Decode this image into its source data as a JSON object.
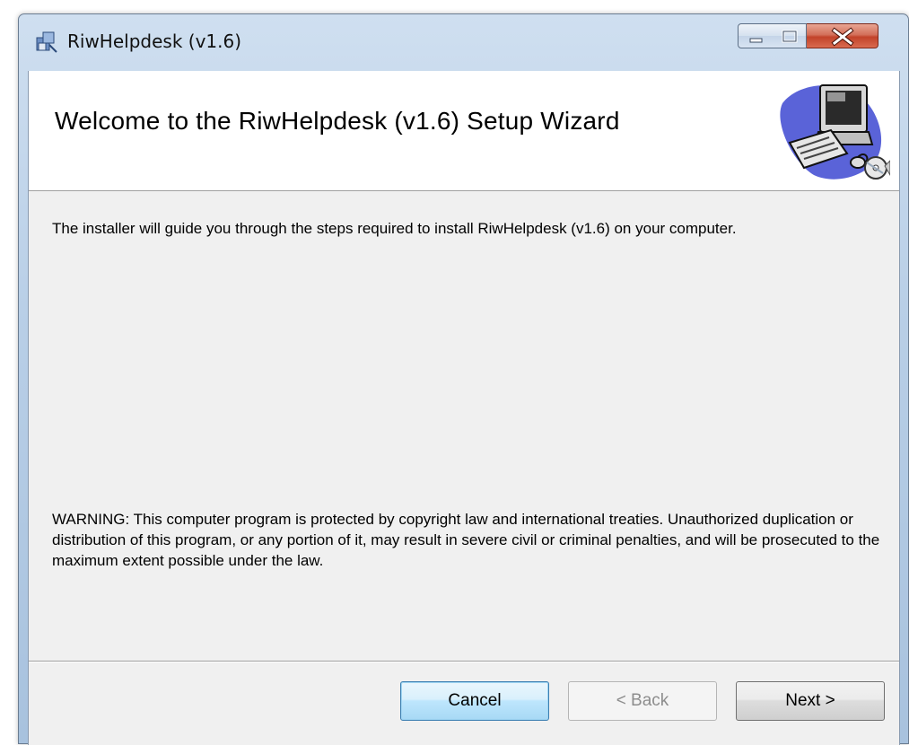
{
  "window": {
    "title": "RiwHelpdesk (v1.6)",
    "controls": {
      "minimize": "minimize-icon",
      "maximize": "maximize-icon",
      "close": "close-icon"
    }
  },
  "banner": {
    "title": "Welcome to the RiwHelpdesk (v1.6) Setup Wizard",
    "art": "computer-setup-icon"
  },
  "content": {
    "intro": "The installer will guide you through the steps required to install RiwHelpdesk (v1.6) on your computer.",
    "warning": "WARNING: This computer program is protected by copyright law and international treaties. Unauthorized duplication or distribution of this program, or any portion of it, may result in severe civil or criminal penalties, and will be prosecuted to the maximum extent possible under the law."
  },
  "buttons": {
    "cancel": "Cancel",
    "back": "< Back",
    "next": "Next >"
  },
  "colors": {
    "accent_button_border": "#3c7fb1",
    "close_button": "#c2432a",
    "disabled_text": "#8d8d8d"
  }
}
